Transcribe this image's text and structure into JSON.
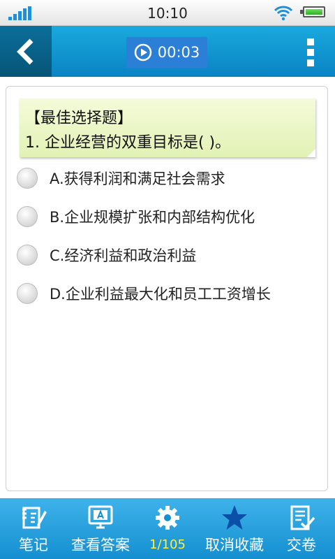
{
  "status_bar": {
    "time": "10:10"
  },
  "header": {
    "timer": "00:03"
  },
  "question": {
    "type": "【最佳选择题】",
    "text": "1. 企业经营的双重目标是(   )。"
  },
  "options": [
    {
      "label": "A.获得利润和满足社会需求"
    },
    {
      "label": "B.企业规模扩张和内部结构优化"
    },
    {
      "label": "C.经济利益和政治利益"
    },
    {
      "label": "D.企业利益最大化和员工工资增长"
    }
  ],
  "toolbar": {
    "notes": "笔记",
    "view_answer": "查看答案",
    "progress": "1/105",
    "unfavorite": "取消收藏",
    "submit": "交卷"
  },
  "colors": {
    "header": "#0a83c4",
    "toolbar": "#148fd0",
    "progress_text": "#ffef40"
  },
  "icons": [
    "signal-icon",
    "wifi-icon",
    "battery-icon",
    "back-arrow-icon",
    "play-icon",
    "more-vertical-icon",
    "notes-icon",
    "answer-screen-icon",
    "gear-icon",
    "star-icon",
    "submit-icon"
  ]
}
